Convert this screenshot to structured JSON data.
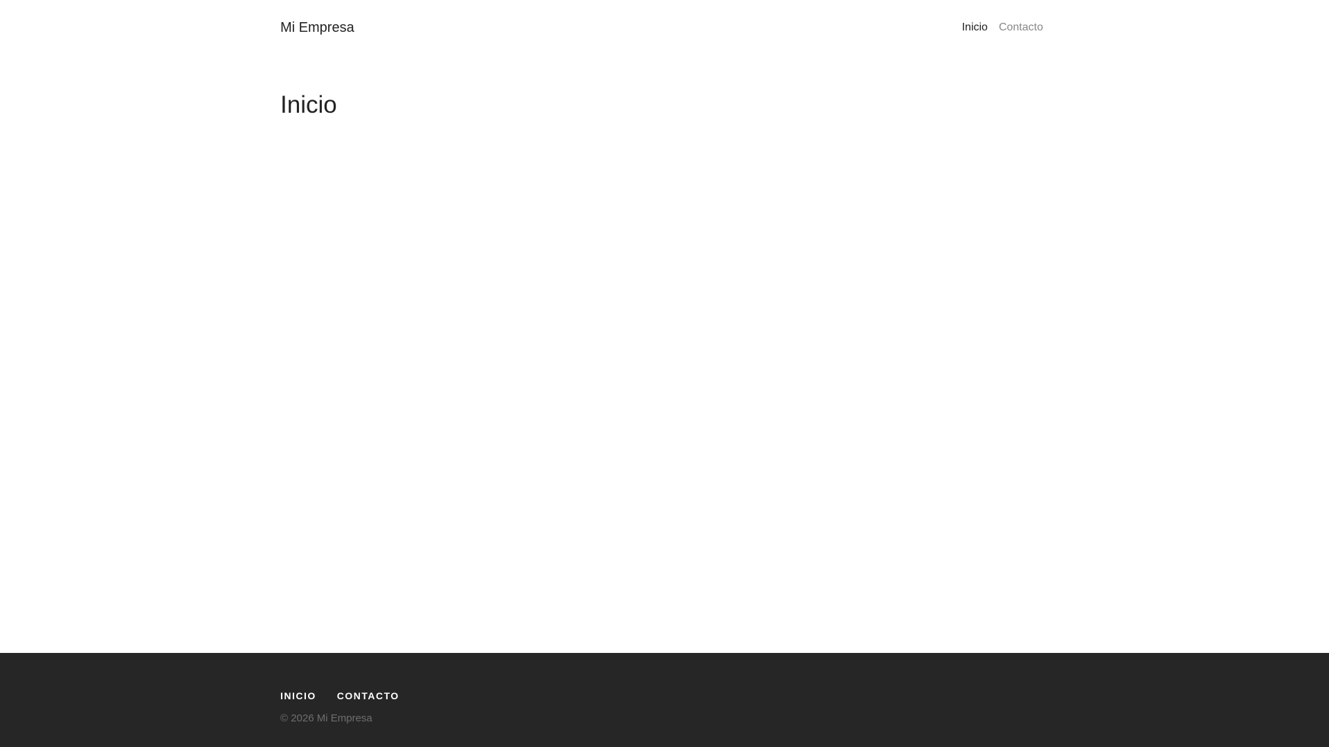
{
  "header": {
    "brand": "Mi Empresa",
    "nav": [
      {
        "label": "Inicio",
        "active": true
      },
      {
        "label": "Contacto",
        "active": false
      }
    ]
  },
  "main": {
    "title": "Inicio"
  },
  "footer": {
    "nav": [
      {
        "label": "INICIO"
      },
      {
        "label": "CONTACTO"
      }
    ],
    "copyright": "© 2026 Mi Empresa"
  },
  "colors": {
    "background": "#ffffff",
    "text": "#222222",
    "nav_inactive": "#888888",
    "footer_bg": "#262626",
    "footer_link": "#ffffff",
    "footer_copyright": "#6e6e6e"
  }
}
